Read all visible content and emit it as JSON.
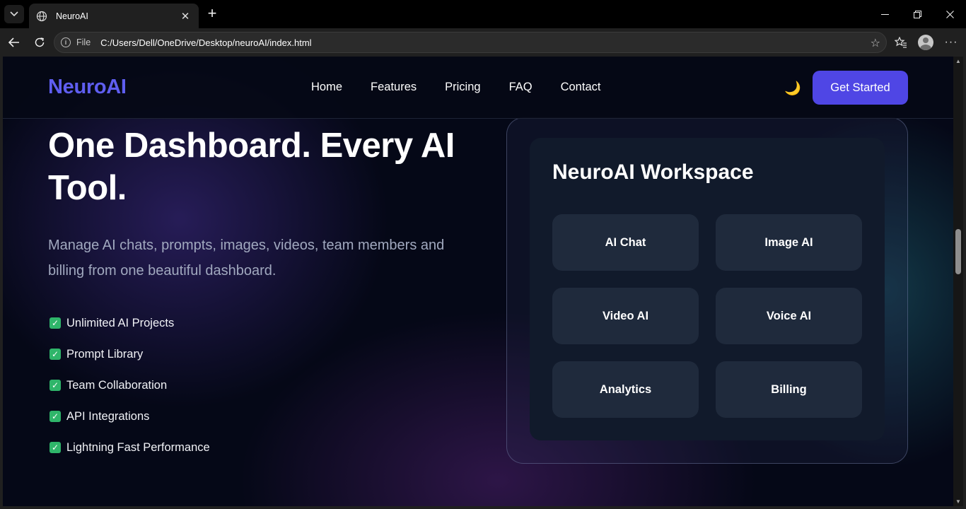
{
  "browser": {
    "tab_title": "NeuroAI",
    "url_scheme": "File",
    "url": "C:/Users/Dell/OneDrive/Desktop/neuroAI/index.html",
    "icons": [
      "tab-list-icon",
      "globe-icon",
      "close-icon",
      "plus-icon",
      "minimize-icon",
      "maximize-icon",
      "window-close-icon",
      "back-icon",
      "reload-icon",
      "info-icon",
      "star-icon",
      "favorites-icon",
      "profile-icon",
      "more-icon"
    ]
  },
  "header": {
    "logo": "NeuroAI",
    "nav": [
      "Home",
      "Features",
      "Pricing",
      "FAQ",
      "Contact"
    ],
    "theme_toggle": "🌙",
    "cta": "Get Started"
  },
  "hero": {
    "title": "One Dashboard. Every AI Tool.",
    "subtitle": "Manage AI chats, prompts, images, videos, team members and billing from one beautiful dashboard.",
    "features": [
      "Unlimited AI Projects",
      "Prompt Library",
      "Team Collaboration",
      "API Integrations",
      "Lightning Fast Performance"
    ]
  },
  "workspace": {
    "title": "NeuroAI Workspace",
    "tools": [
      "AI Chat",
      "Image AI",
      "Video AI",
      "Voice AI",
      "Analytics",
      "Billing"
    ]
  },
  "colors": {
    "accent": "#4f46e5",
    "logo": "#5f5ef0",
    "check": "#2fb56a",
    "background": "#050817",
    "card": "#111a2b",
    "tool_card": "#1f2a3c"
  }
}
